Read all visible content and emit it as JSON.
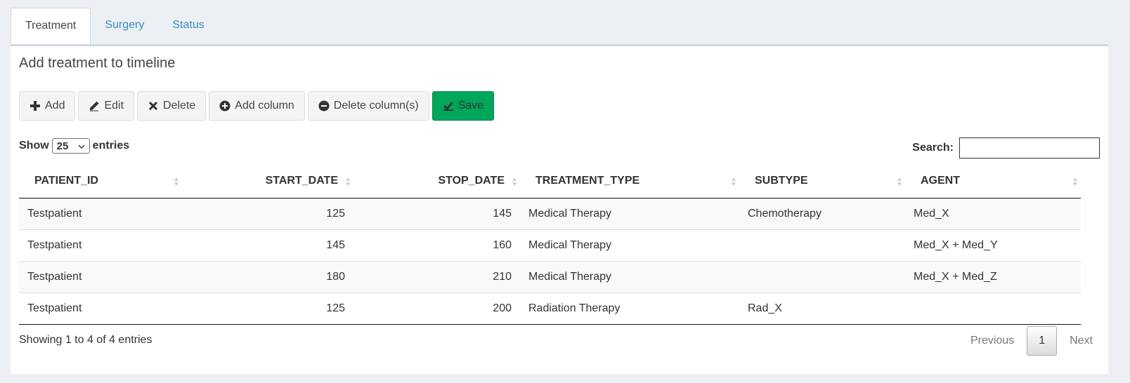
{
  "tabs": [
    {
      "label": "Treatment",
      "active": true
    },
    {
      "label": "Surgery",
      "active": false
    },
    {
      "label": "Status",
      "active": false
    }
  ],
  "panel": {
    "title": "Add treatment to timeline"
  },
  "toolbar": {
    "add": "Add",
    "edit": "Edit",
    "delete": "Delete",
    "add_column": "Add column",
    "delete_columns": "Delete column(s)",
    "save": "Save",
    "save_color": "#00a65a"
  },
  "length": {
    "prefix": "Show",
    "value": "25",
    "suffix": "entries"
  },
  "search": {
    "label": "Search:",
    "value": ""
  },
  "table": {
    "columns": [
      "PATIENT_ID",
      "START_DATE",
      "STOP_DATE",
      "TREATMENT_TYPE",
      "SUBTYPE",
      "AGENT"
    ],
    "rows": [
      [
        "Testpatient",
        "125",
        "145",
        "Medical Therapy",
        "Chemotherapy",
        "Med_X"
      ],
      [
        "Testpatient",
        "145",
        "160",
        "Medical Therapy",
        "",
        "Med_X + Med_Y"
      ],
      [
        "Testpatient",
        "180",
        "210",
        "Medical Therapy",
        "",
        "Med_X + Med_Z"
      ],
      [
        "Testpatient",
        "125",
        "200",
        "Radiation Therapy",
        "Rad_X",
        ""
      ]
    ]
  },
  "footer": {
    "info": "Showing 1 to 4 of 4 entries",
    "previous": "Previous",
    "page": "1",
    "next": "Next"
  }
}
